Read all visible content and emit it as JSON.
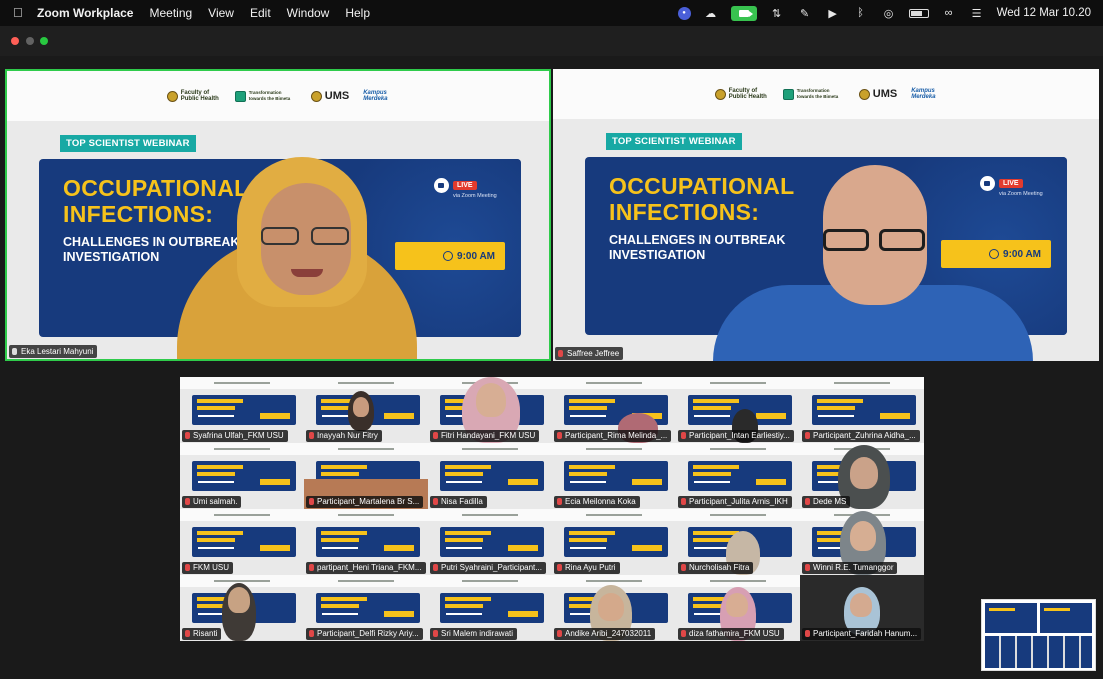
{
  "menubar": {
    "app_name": "Zoom Workplace",
    "menus": [
      "Meeting",
      "View",
      "Edit",
      "Window",
      "Help"
    ],
    "clock": "Wed 12 Mar  10.20"
  },
  "slide": {
    "tag": "TOP SCIENTIST WEBINAR",
    "title_line1": "OCCUPATIONAL",
    "title_line2": "INFECTIONS:",
    "sub_line1": "CHALLENGES IN OUTBREAK",
    "sub_line2": "INVESTIGATION",
    "live": "LIVE",
    "live_caption": "via Zoom Meeting",
    "time": "9:00 AM",
    "logos": {
      "faculty": "Faculty of Public Health",
      "transformation": "Transformation towards the Bimeta",
      "ums": "UMS",
      "kampus": "Kampus Merdeka"
    }
  },
  "speakers": [
    {
      "name": "Eka Lestari Mahyuni",
      "active": true
    },
    {
      "name": "Saffree Jeffree",
      "active": false
    }
  ],
  "gallery": [
    [
      "Syafrina Ulfah_FKM USU",
      "Inayyah Nur Fitry",
      "Fitri Handayani_FKM USU",
      "Participant_Rima Melinda_...",
      "Participant_Intan Earliestiy...",
      "Participant_Zuhrina Aidha_..."
    ],
    [
      "Umi salmah.",
      "Participant_Martalena Br S...",
      "Nisa Fadilla",
      "Ecia Meilonna Koka",
      "Participant_Julita Arnis_IKH",
      "Dede MS"
    ],
    [
      "FKM USU",
      "partipant_Heni Triana_FKM...",
      "Putri Syahraini_Participant...",
      "Rina Ayu Putri",
      "Nurcholisah Fitra",
      "Winni R.E. Tumanggor"
    ],
    [
      "Risanti",
      "Participant_Delfi Rizky Ariy...",
      "Sri Malem indirawati",
      "Andike Aribi_247032011",
      "diza fathamira_FKM USU",
      "Participant_Faridah Hanum..."
    ]
  ]
}
